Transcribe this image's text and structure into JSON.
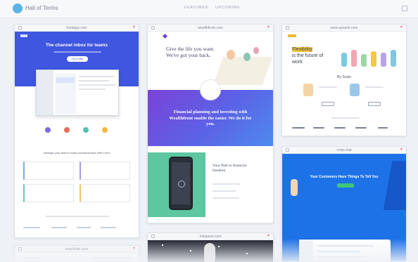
{
  "app": {
    "brand": "Hall of Terms",
    "separator": "/"
  },
  "nav": {
    "tab_features": "FEATURED",
    "tab_upcoming": "UPCOMING"
  },
  "cards": {
    "frontapp": {
      "title": "frontapp.com",
      "headline": "The channel inbox for teams",
      "cta": "Try it free",
      "tagline": "Manage your team's email communication with Front"
    },
    "wealthfront": {
      "title": "wealthfront.com",
      "headline": "Give the life you want. We've got your back.",
      "banner": "Financial planning and investing with Wealthfront enable the easier. We do it for you.",
      "section": "Your Path to financial freedom"
    },
    "upwork": {
      "title": "www.upwork.com",
      "headline": "Flexibility is the future of work",
      "section": "By Scale"
    },
    "crisp": {
      "title": "crisp.chat",
      "headline": "Your Customers Have Things To Tell You"
    },
    "bottom_left": {
      "title": "amplitude.com"
    },
    "bottom_mid": {
      "title": "mixpanel.com"
    }
  },
  "colors": {
    "front_blue": "#3e56e0",
    "wealthfront_purple": "#6d47d9",
    "crisp_blue": "#1e72e8",
    "upwork_yellow": "#f5c842",
    "accent_green": "#5cc7a0"
  }
}
